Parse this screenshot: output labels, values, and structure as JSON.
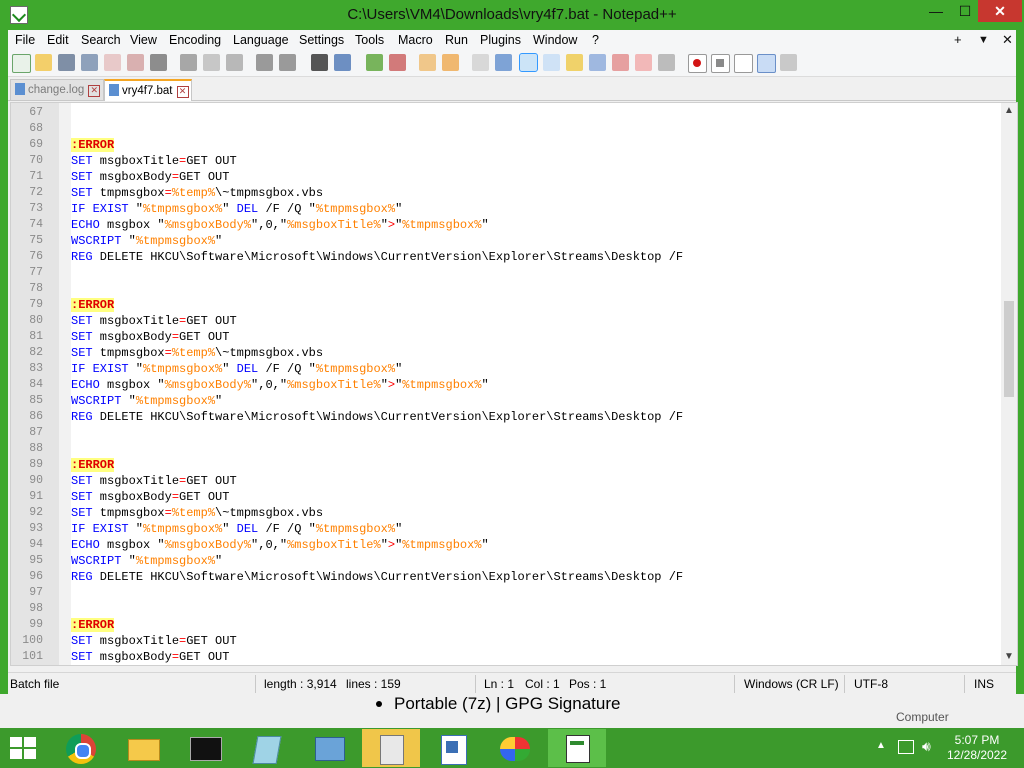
{
  "window": {
    "title": "C:\\Users\\VM4\\Downloads\\vry4f7.bat - Notepad++",
    "min_glyph": "—",
    "max_glyph": "☐",
    "close_glyph": "✕"
  },
  "menu": {
    "items": [
      "File",
      "Edit",
      "Search",
      "View",
      "Encoding",
      "Language",
      "Settings",
      "Tools",
      "Macro",
      "Run",
      "Plugins",
      "Window",
      "?"
    ],
    "right_plus": "+",
    "right_down": "▼",
    "right_close": "✕"
  },
  "tabs": [
    {
      "label": "change.log",
      "active": false
    },
    {
      "label": "vry4f7.bat",
      "active": true
    }
  ],
  "editor": {
    "lines": [
      {
        "n": "67",
        "segs": []
      },
      {
        "n": "68",
        "segs": []
      },
      {
        "n": "69",
        "segs": [
          [
            "lbl",
            ":ERROR"
          ]
        ]
      },
      {
        "n": "70",
        "segs": [
          [
            "kw",
            "SET"
          ],
          [
            "",
            " msgboxTitle"
          ],
          [
            "op",
            "="
          ],
          [
            "",
            "GET OUT"
          ]
        ]
      },
      {
        "n": "71",
        "segs": [
          [
            "kw",
            "SET"
          ],
          [
            "",
            " msgboxBody"
          ],
          [
            "op",
            "="
          ],
          [
            "",
            "GET OUT"
          ]
        ]
      },
      {
        "n": "72",
        "segs": [
          [
            "kw",
            "SET"
          ],
          [
            "",
            " tmpmsgbox"
          ],
          [
            "op",
            "="
          ],
          [
            "var",
            "%temp%"
          ],
          [
            "",
            "\\~tmpmsgbox.vbs"
          ]
        ]
      },
      {
        "n": "73",
        "segs": [
          [
            "kw",
            "IF EXIST"
          ],
          [
            "",
            " \""
          ],
          [
            "var",
            "%tmpmsgbox%"
          ],
          [
            "",
            "\" "
          ],
          [
            "kw",
            "DEL"
          ],
          [
            "",
            " /F /Q \""
          ],
          [
            "var",
            "%tmpmsgbox%"
          ],
          [
            "",
            "\""
          ]
        ]
      },
      {
        "n": "74",
        "segs": [
          [
            "kw",
            "ECHO"
          ],
          [
            "",
            " msgbox \""
          ],
          [
            "var",
            "%msgboxBody%"
          ],
          [
            "",
            "\",0,\""
          ],
          [
            "var",
            "%msgboxTitle%"
          ],
          [
            "",
            "\""
          ],
          [
            "op",
            ">"
          ],
          [
            "",
            "\""
          ],
          [
            "var",
            "%tmpmsgbox%"
          ],
          [
            "",
            "\""
          ]
        ]
      },
      {
        "n": "75",
        "segs": [
          [
            "kw",
            "WSCRIPT"
          ],
          [
            "",
            " \""
          ],
          [
            "var",
            "%tmpmsgbox%"
          ],
          [
            "",
            "\""
          ]
        ]
      },
      {
        "n": "76",
        "segs": [
          [
            "kw",
            "REG"
          ],
          [
            "",
            " DELETE HKCU\\Software\\Microsoft\\Windows\\CurrentVersion\\Explorer\\Streams\\Desktop /F"
          ]
        ]
      },
      {
        "n": "77",
        "segs": []
      },
      {
        "n": "78",
        "segs": []
      },
      {
        "n": "79",
        "segs": [
          [
            "lbl",
            ":ERROR"
          ]
        ]
      },
      {
        "n": "80",
        "segs": [
          [
            "kw",
            "SET"
          ],
          [
            "",
            " msgboxTitle"
          ],
          [
            "op",
            "="
          ],
          [
            "",
            "GET OUT"
          ]
        ]
      },
      {
        "n": "81",
        "segs": [
          [
            "kw",
            "SET"
          ],
          [
            "",
            " msgboxBody"
          ],
          [
            "op",
            "="
          ],
          [
            "",
            "GET OUT"
          ]
        ]
      },
      {
        "n": "82",
        "segs": [
          [
            "kw",
            "SET"
          ],
          [
            "",
            " tmpmsgbox"
          ],
          [
            "op",
            "="
          ],
          [
            "var",
            "%temp%"
          ],
          [
            "",
            "\\~tmpmsgbox.vbs"
          ]
        ]
      },
      {
        "n": "83",
        "segs": [
          [
            "kw",
            "IF EXIST"
          ],
          [
            "",
            " \""
          ],
          [
            "var",
            "%tmpmsgbox%"
          ],
          [
            "",
            "\" "
          ],
          [
            "kw",
            "DEL"
          ],
          [
            "",
            " /F /Q \""
          ],
          [
            "var",
            "%tmpmsgbox%"
          ],
          [
            "",
            "\""
          ]
        ]
      },
      {
        "n": "84",
        "segs": [
          [
            "kw",
            "ECHO"
          ],
          [
            "",
            " msgbox \""
          ],
          [
            "var",
            "%msgboxBody%"
          ],
          [
            "",
            "\",0,\""
          ],
          [
            "var",
            "%msgboxTitle%"
          ],
          [
            "",
            "\""
          ],
          [
            "op",
            ">"
          ],
          [
            "",
            "\""
          ],
          [
            "var",
            "%tmpmsgbox%"
          ],
          [
            "",
            "\""
          ]
        ]
      },
      {
        "n": "85",
        "segs": [
          [
            "kw",
            "WSCRIPT"
          ],
          [
            "",
            " \""
          ],
          [
            "var",
            "%tmpmsgbox%"
          ],
          [
            "",
            "\""
          ]
        ]
      },
      {
        "n": "86",
        "segs": [
          [
            "kw",
            "REG"
          ],
          [
            "",
            " DELETE HKCU\\Software\\Microsoft\\Windows\\CurrentVersion\\Explorer\\Streams\\Desktop /F"
          ]
        ]
      },
      {
        "n": "87",
        "segs": []
      },
      {
        "n": "88",
        "segs": []
      },
      {
        "n": "89",
        "segs": [
          [
            "lbl",
            ":ERROR"
          ]
        ]
      },
      {
        "n": "90",
        "segs": [
          [
            "kw",
            "SET"
          ],
          [
            "",
            " msgboxTitle"
          ],
          [
            "op",
            "="
          ],
          [
            "",
            "GET OUT"
          ]
        ]
      },
      {
        "n": "91",
        "segs": [
          [
            "kw",
            "SET"
          ],
          [
            "",
            " msgboxBody"
          ],
          [
            "op",
            "="
          ],
          [
            "",
            "GET OUT"
          ]
        ]
      },
      {
        "n": "92",
        "segs": [
          [
            "kw",
            "SET"
          ],
          [
            "",
            " tmpmsgbox"
          ],
          [
            "op",
            "="
          ],
          [
            "var",
            "%temp%"
          ],
          [
            "",
            "\\~tmpmsgbox.vbs"
          ]
        ]
      },
      {
        "n": "93",
        "segs": [
          [
            "kw",
            "IF EXIST"
          ],
          [
            "",
            " \""
          ],
          [
            "var",
            "%tmpmsgbox%"
          ],
          [
            "",
            "\" "
          ],
          [
            "kw",
            "DEL"
          ],
          [
            "",
            " /F /Q \""
          ],
          [
            "var",
            "%tmpmsgbox%"
          ],
          [
            "",
            "\""
          ]
        ]
      },
      {
        "n": "94",
        "segs": [
          [
            "kw",
            "ECHO"
          ],
          [
            "",
            " msgbox \""
          ],
          [
            "var",
            "%msgboxBody%"
          ],
          [
            "",
            "\",0,\""
          ],
          [
            "var",
            "%msgboxTitle%"
          ],
          [
            "",
            "\""
          ],
          [
            "op",
            ">"
          ],
          [
            "",
            "\""
          ],
          [
            "var",
            "%tmpmsgbox%"
          ],
          [
            "",
            "\""
          ]
        ]
      },
      {
        "n": "95",
        "segs": [
          [
            "kw",
            "WSCRIPT"
          ],
          [
            "",
            " \""
          ],
          [
            "var",
            "%tmpmsgbox%"
          ],
          [
            "",
            "\""
          ]
        ]
      },
      {
        "n": "96",
        "segs": [
          [
            "kw",
            "REG"
          ],
          [
            "",
            " DELETE HKCU\\Software\\Microsoft\\Windows\\CurrentVersion\\Explorer\\Streams\\Desktop /F"
          ]
        ]
      },
      {
        "n": "97",
        "segs": []
      },
      {
        "n": "98",
        "segs": []
      },
      {
        "n": "99",
        "segs": [
          [
            "lbl",
            ":ERROR"
          ]
        ]
      },
      {
        "n": "100",
        "segs": [
          [
            "kw",
            "SET"
          ],
          [
            "",
            " msgboxTitle"
          ],
          [
            "op",
            "="
          ],
          [
            "",
            "GET OUT"
          ]
        ]
      },
      {
        "n": "101",
        "segs": [
          [
            "kw",
            "SET"
          ],
          [
            "",
            " msgboxBody"
          ],
          [
            "op",
            "="
          ],
          [
            "",
            "GET OUT"
          ]
        ]
      }
    ],
    "scroll_up": "▲",
    "scroll_down": "▼"
  },
  "status": {
    "file_type": "Batch file",
    "length": "length : 3,914",
    "lines": "lines : 159",
    "ln": "Ln : 1",
    "col": "Col : 1",
    "pos": "Pos : 1",
    "eol": "Windows (CR LF)",
    "encoding": "UTF-8",
    "mode": "INS"
  },
  "background_window": {
    "bullet_text": "Portable (7z) | GPG Signature",
    "computer_text": "Computer"
  },
  "taskbar": {
    "apps": [
      "chrome-icon",
      "file-explorer-icon",
      "command-prompt-icon",
      "notepad-icon",
      "control-panel-icon",
      "calculator-icon",
      "wordpad-icon",
      "paint-icon",
      "notepad-plus-plus-icon"
    ],
    "time": "5:07 PM",
    "date": "12/28/2022"
  },
  "colors": {
    "window_frame": "#3fa82d",
    "keyword": "#0000ff",
    "variable": "#ff8000",
    "label_fg": "#e00000",
    "label_bg": "#ffff80"
  }
}
